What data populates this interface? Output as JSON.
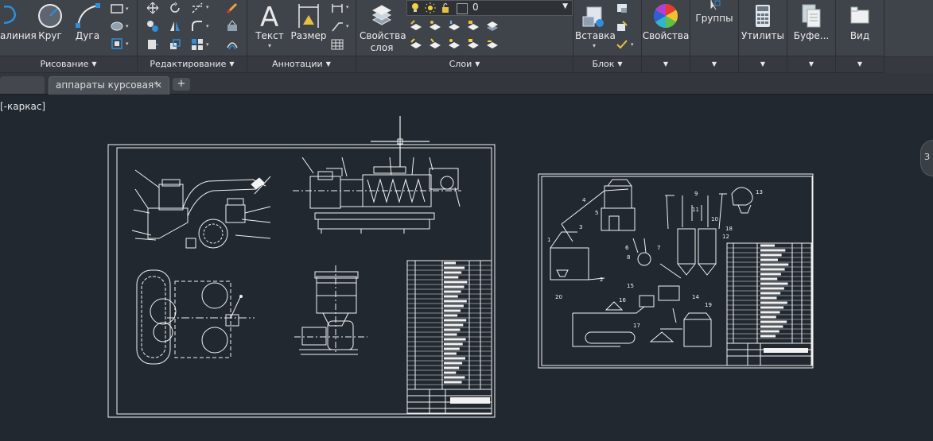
{
  "ribbon": {
    "draw_panel": {
      "polyline_label": "алиния",
      "circle_label": "Круг",
      "arc_label": "Дуга",
      "footer": "Рисование"
    },
    "modify_panel": {
      "footer": "Редактирование"
    },
    "annotation_panel": {
      "text_label": "Текст",
      "dimension_label": "Размер",
      "footer": "Аннотации"
    },
    "layers_panel": {
      "layer_props_label_1": "Свойства",
      "layer_props_label_2": "слоя",
      "current_layer": "0",
      "footer": "Слои"
    },
    "block_panel": {
      "insert_label": "Вставка",
      "footer": "Блок"
    },
    "properties_label": "Свойства",
    "groups_label": "Группы",
    "utilities_label": "Утилиты",
    "clipboard_label": "Буфе...",
    "view_label": "Вид",
    "colors": {
      "layer_color": "#000000",
      "accent_blue": "#2f8fd8",
      "bulb": "#f2d33a"
    }
  },
  "tabs": {
    "active_label": "аппараты курсовая*",
    "close_glyph": "✕",
    "new_tab_glyph": "+"
  },
  "canvas": {
    "viewport_label": "[-каркас]",
    "viewcube_label": "З",
    "sheet2_callouts": [
      "1",
      "2",
      "3",
      "4",
      "5",
      "6",
      "7",
      "8",
      "9",
      "10",
      "11",
      "12",
      "13",
      "14",
      "15",
      "16",
      "17",
      "18",
      "19",
      "20"
    ]
  }
}
